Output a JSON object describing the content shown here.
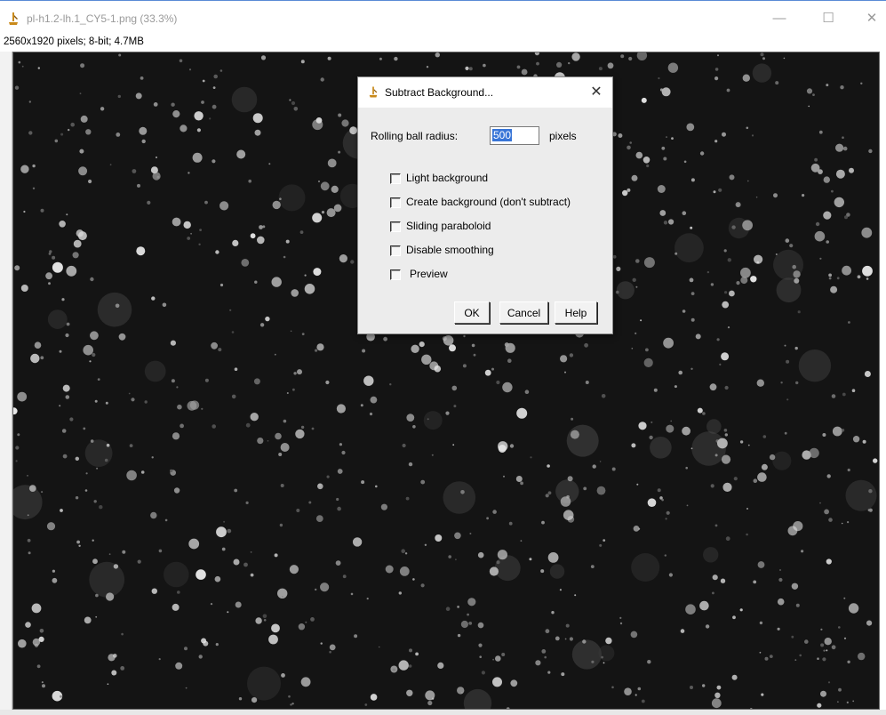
{
  "window": {
    "title": "pl-h1.2-lh.1_CY5-1.png (33.3%)",
    "status": "2560x1920 pixels; 8-bit; 4.7MB",
    "controls": {
      "minimize": "—",
      "maximize": "☐",
      "close": "✕"
    }
  },
  "dialog": {
    "title": "Subtract Background...",
    "close": "✕",
    "radius_label": "Rolling ball radius:",
    "radius_value": "500",
    "radius_unit": "pixels",
    "options": [
      {
        "label": "Light background",
        "checked": false
      },
      {
        "label": "Create background (don't subtract)",
        "checked": false
      },
      {
        "label": "Sliding paraboloid",
        "checked": false
      },
      {
        "label": "Disable smoothing",
        "checked": false
      },
      {
        "label": "Preview",
        "checked": false
      }
    ],
    "buttons": {
      "ok": "OK",
      "cancel": "Cancel",
      "help": "Help"
    }
  },
  "colors": {
    "image_background": "#141414",
    "selection_highlight": "#3875d7",
    "dialog_background": "#ececec",
    "app_icon": "#c98a1a"
  }
}
